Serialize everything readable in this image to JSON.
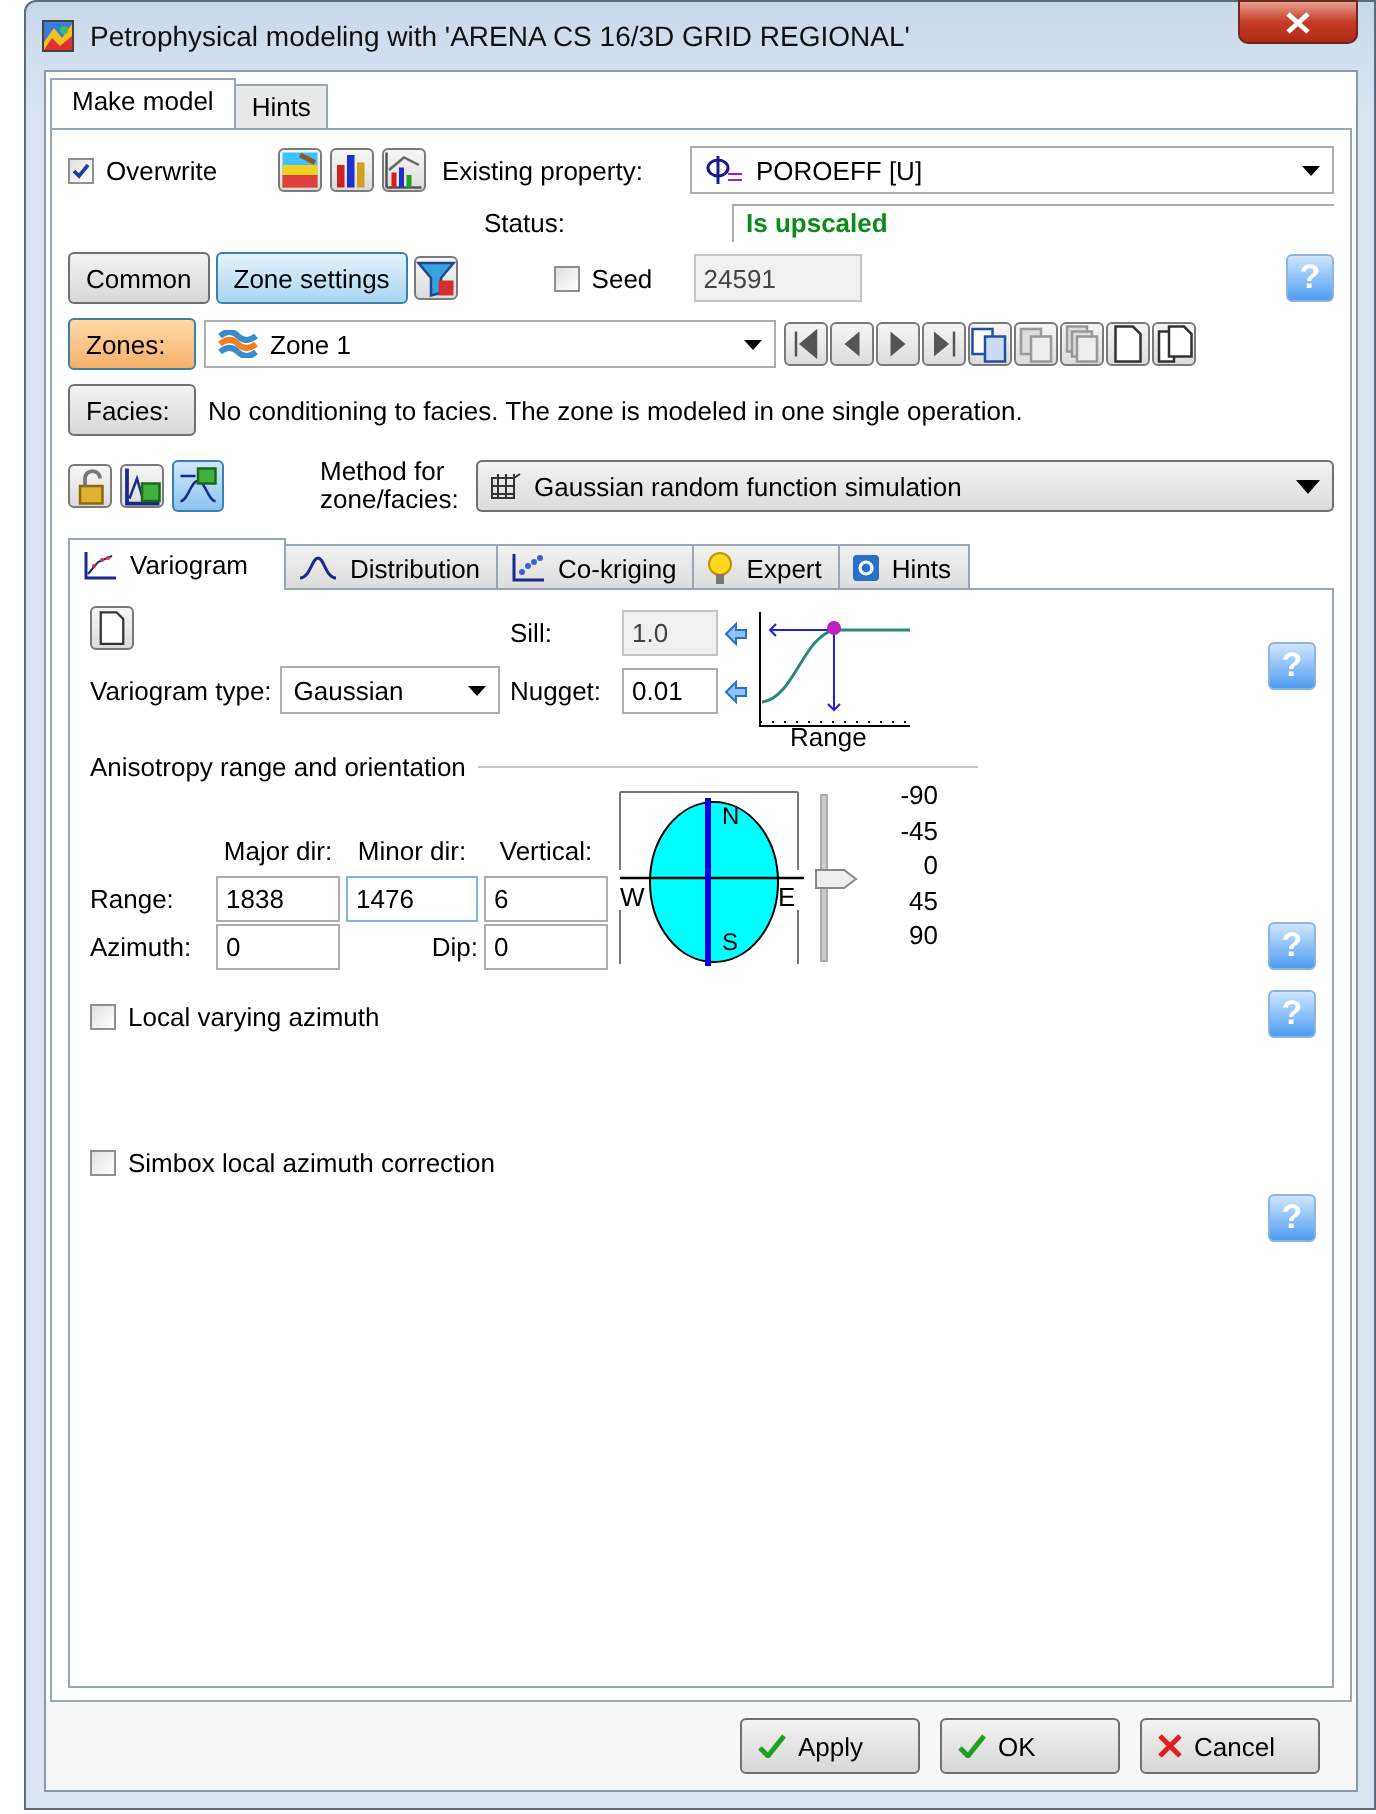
{
  "window": {
    "title": "Petrophysical modeling with 'ARENA CS 16/3D GRID REGIONAL'"
  },
  "tabs": [
    {
      "label": "Make model",
      "selected": true
    },
    {
      "label": "Hints",
      "selected": false
    }
  ],
  "overwrite": {
    "label": "Overwrite",
    "checked": true
  },
  "existing_property": {
    "label": "Existing property:",
    "value": "POROEFF [U]"
  },
  "status": {
    "label": "Status:",
    "value": "Is upscaled"
  },
  "mode_buttons": [
    {
      "label": "Common",
      "selected": false
    },
    {
      "label": "Zone settings",
      "selected": true
    }
  ],
  "seed": {
    "label": "Seed",
    "checked": false,
    "value": "24591",
    "disabled": true
  },
  "help": "?",
  "zones": {
    "button": "Zones:",
    "value": "Zone 1"
  },
  "facies": {
    "button": "Facies:",
    "text": "No conditioning to facies. The zone is modeled in one single operation."
  },
  "method": {
    "label": "Method for zone/facies:",
    "value": "Gaussian random function simulation"
  },
  "subtabs": [
    {
      "label": "Variogram",
      "kind": "variogram",
      "selected": true
    },
    {
      "label": "Distribution",
      "kind": "distribution",
      "selected": false
    },
    {
      "label": "Co-kriging",
      "kind": "cokriging",
      "selected": false
    },
    {
      "label": "Expert",
      "kind": "expert",
      "selected": false
    },
    {
      "label": "Hints",
      "kind": "hints",
      "selected": false
    }
  ],
  "variogram": {
    "sill_label": "Sill:",
    "sill": "1.0",
    "sill_disabled": true,
    "type_label": "Variogram type:",
    "type": "Gaussian",
    "nugget_label": "Nugget:",
    "nugget": "0.01",
    "help": "?",
    "range_title": "Range",
    "group_title": "Anisotropy range and orientation",
    "columns": [
      "Major dir:",
      "Minor dir:",
      "Vertical:"
    ],
    "range_label": "Range:",
    "range": [
      "1838",
      "1476",
      "6"
    ],
    "azimuth_label": "Azimuth:",
    "azimuth": "0",
    "dip_label": "Dip:",
    "dip": "0",
    "help2": "?",
    "compass": {
      "n": "N",
      "e": "E",
      "s": "S",
      "w": "W"
    },
    "slider": {
      "level": 0.5,
      "ticks": [
        "-90",
        "-45",
        "0",
        "45",
        "90"
      ]
    }
  },
  "options": [
    {
      "label": "Local varying azimuth",
      "checked": false,
      "help": "?"
    },
    {
      "label": "Simbox local azimuth correction",
      "checked": false,
      "help": "?"
    }
  ],
  "buttons": [
    {
      "label": "Apply",
      "kind": "confirm"
    },
    {
      "label": "OK",
      "kind": "confirm"
    },
    {
      "label": "Cancel",
      "kind": "cancel"
    }
  ]
}
